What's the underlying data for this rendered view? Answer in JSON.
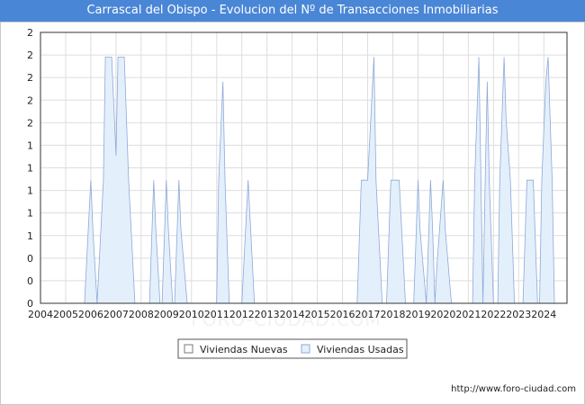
{
  "chart_data": {
    "type": "area",
    "title": "Carrascal del Obispo - Evolucion del Nº de Transacciones Inmobiliarias",
    "xlabel": "",
    "ylabel": "",
    "x_ticks": [
      "2004",
      "2005",
      "2006",
      "2007",
      "2008",
      "2009",
      "2010",
      "2011",
      "2012",
      "2013",
      "2014",
      "2015",
      "2016",
      "2017",
      "2018",
      "2019",
      "2020",
      "2021",
      "2022",
      "2023",
      "2024"
    ],
    "y_ticks": [
      "0",
      "0",
      "0",
      "1",
      "1",
      "1",
      "1",
      "1",
      "2",
      "2",
      "2",
      "2"
    ],
    "ylim": [
      0,
      2.2
    ],
    "xlim": [
      2004,
      2024.92
    ],
    "grid": true,
    "legend_position": "bottom",
    "series": [
      {
        "name": "Viviendas Nuevas",
        "color": "#ffffff",
        "stroke": "#7a7a7a",
        "points": []
      },
      {
        "name": "Viviendas Usadas",
        "color": "#e3f0fb",
        "stroke": "#8fa8d8",
        "points": [
          [
            2005.75,
            0
          ],
          [
            2006.0,
            1.0
          ],
          [
            2006.08,
            0.6
          ],
          [
            2006.25,
            0
          ],
          [
            2006.5,
            1.0
          ],
          [
            2006.58,
            2.0
          ],
          [
            2006.83,
            2.0
          ],
          [
            2007.0,
            1.2
          ],
          [
            2007.08,
            2.0
          ],
          [
            2007.33,
            2.0
          ],
          [
            2007.5,
            1.0
          ],
          [
            2007.75,
            0
          ],
          [
            2008.33,
            0
          ],
          [
            2008.5,
            1.0
          ],
          [
            2008.58,
            0.6
          ],
          [
            2008.75,
            0
          ],
          [
            2008.83,
            0
          ],
          [
            2009.0,
            1.0
          ],
          [
            2009.08,
            0.6
          ],
          [
            2009.25,
            0
          ],
          [
            2009.33,
            0
          ],
          [
            2009.5,
            1.0
          ],
          [
            2009.58,
            0.6
          ],
          [
            2009.83,
            0
          ],
          [
            2011.0,
            0
          ],
          [
            2011.08,
            1.0
          ],
          [
            2011.25,
            1.8
          ],
          [
            2011.33,
            1.0
          ],
          [
            2011.5,
            0
          ],
          [
            2012.0,
            0
          ],
          [
            2012.25,
            1.0
          ],
          [
            2012.5,
            0
          ],
          [
            2016.58,
            0
          ],
          [
            2016.75,
            1.0
          ],
          [
            2017.0,
            1.0
          ],
          [
            2017.25,
            2.0
          ],
          [
            2017.33,
            1.0
          ],
          [
            2017.58,
            0
          ],
          [
            2017.75,
            0
          ],
          [
            2017.92,
            1.0
          ],
          [
            2018.25,
            1.0
          ],
          [
            2018.5,
            0
          ],
          [
            2018.83,
            0
          ],
          [
            2019.0,
            1.0
          ],
          [
            2019.08,
            0.6
          ],
          [
            2019.33,
            0
          ],
          [
            2019.5,
            1.0
          ],
          [
            2019.58,
            0.6
          ],
          [
            2019.67,
            0
          ],
          [
            2019.75,
            0.3
          ],
          [
            2020.0,
            1.0
          ],
          [
            2020.08,
            0.6
          ],
          [
            2020.33,
            0
          ],
          [
            2021.17,
            0
          ],
          [
            2021.25,
            1.0
          ],
          [
            2021.42,
            2.0
          ],
          [
            2021.5,
            1.0
          ],
          [
            2021.58,
            0
          ],
          [
            2021.67,
            1.0
          ],
          [
            2021.75,
            1.8
          ],
          [
            2021.83,
            1.0
          ],
          [
            2022.0,
            0
          ],
          [
            2022.17,
            0
          ],
          [
            2022.25,
            1.0
          ],
          [
            2022.42,
            2.0
          ],
          [
            2022.5,
            1.5
          ],
          [
            2022.67,
            1.0
          ],
          [
            2022.83,
            0
          ],
          [
            2023.17,
            0
          ],
          [
            2023.33,
            1.0
          ],
          [
            2023.58,
            1.0
          ],
          [
            2023.75,
            0
          ],
          [
            2023.83,
            0
          ],
          [
            2023.92,
            1.0
          ],
          [
            2024.08,
            1.8
          ],
          [
            2024.17,
            2.0
          ],
          [
            2024.33,
            1.0
          ],
          [
            2024.42,
            0
          ]
        ]
      }
    ]
  },
  "watermark": "FORO-CIUDAD.COM",
  "source_url": "http://www.foro-ciudad.com"
}
